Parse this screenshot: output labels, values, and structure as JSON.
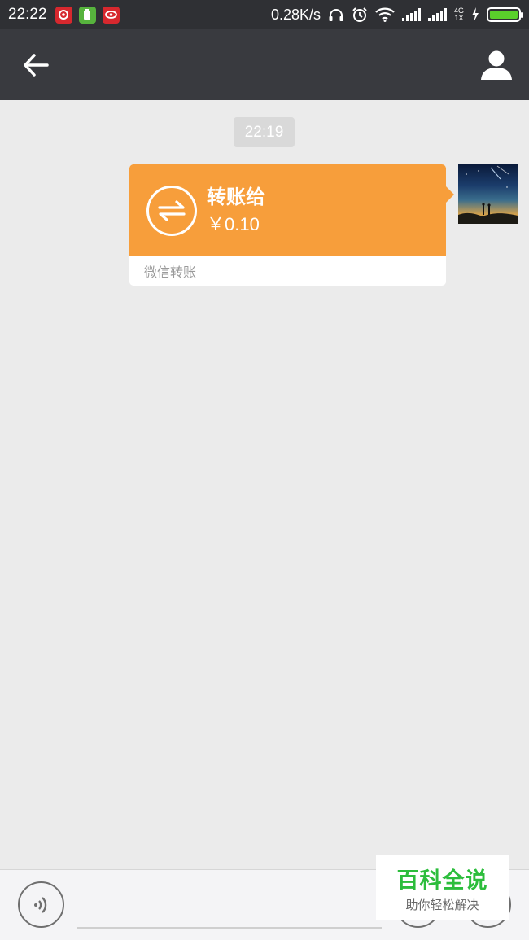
{
  "status_bar": {
    "time": "22:22",
    "net_speed": "0.28K/s",
    "network_type_top": "4G",
    "network_type_bottom": "1X",
    "notifications": [
      "netease-music-icon",
      "cleaner-icon",
      "video-icon"
    ]
  },
  "header": {
    "title": ""
  },
  "chat": {
    "timestamp": "22:19",
    "transfer": {
      "title": "转账给",
      "amount": "￥0.10",
      "footer": "微信转账"
    }
  },
  "input": {
    "value": "",
    "placeholder": ""
  },
  "watermark": {
    "title": "百科全说",
    "subtitle": "助你轻松解决"
  },
  "colors": {
    "status_bar_bg": "#2f3034",
    "header_bg": "#393a3f",
    "chat_bg": "#ebebeb",
    "transfer_orange": "#f79e3b",
    "watermark_green": "#2cbd3c"
  },
  "battery_level": 1.0
}
